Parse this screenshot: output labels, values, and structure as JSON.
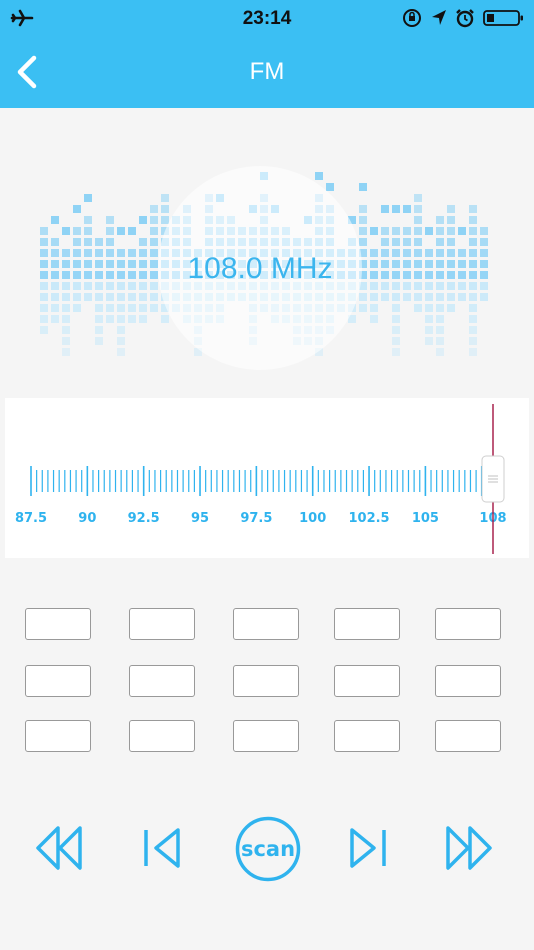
{
  "status_bar": {
    "time": "23:14",
    "icons": [
      "airplane-icon",
      "rotation-lock-icon",
      "location-arrow-icon",
      "alarm-icon",
      "battery-icon"
    ]
  },
  "nav": {
    "title": "FM",
    "back_icon": "chevron-left-icon"
  },
  "frequency": {
    "display": "108.0 MHz",
    "current_mhz": 108.0
  },
  "tuner": {
    "min_mhz": 87.5,
    "max_mhz": 108,
    "scale_labels": [
      "87.5",
      "90",
      "92.5",
      "95",
      "97.5",
      "100",
      "102.5",
      "105",
      "108"
    ],
    "indicator_color": "#a8234e"
  },
  "presets": {
    "rows": 3,
    "cols": 5,
    "labels": [
      "",
      "",
      "",
      "",
      "",
      "",
      "",
      "",
      "",
      "",
      "",
      "",
      "",
      "",
      ""
    ]
  },
  "controls": {
    "scan_label": "scan",
    "buttons": [
      "fast-rewind-icon",
      "skip-previous-icon",
      "scan-button",
      "skip-next-icon",
      "fast-forward-icon"
    ]
  },
  "colors": {
    "accent": "#3bbff3",
    "icon_blue": "#2fb3ee",
    "background": "#f5f5f5"
  }
}
